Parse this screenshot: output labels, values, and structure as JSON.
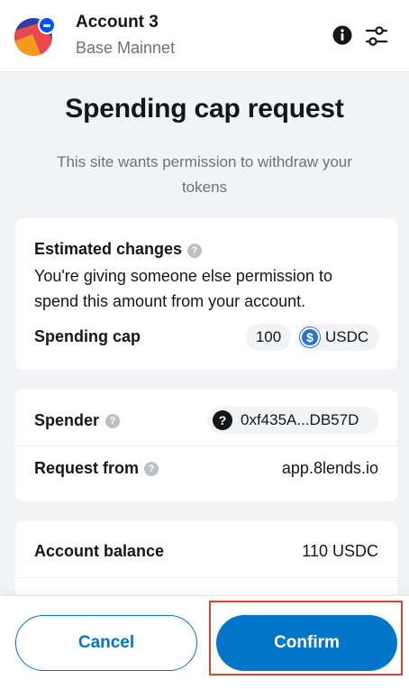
{
  "header": {
    "account_name": "Account 3",
    "network": "Base Mainnet"
  },
  "page": {
    "title": "Spending cap request",
    "subtitle": "This site wants permission to withdraw your tokens"
  },
  "estimated_changes": {
    "label": "Estimated changes",
    "description": "You're giving someone else permission to spend this amount from your account.",
    "spending_cap_label": "Spending cap",
    "amount": "100",
    "token": "USDC"
  },
  "request": {
    "spender_label": "Spender",
    "spender_address": "0xf435A...DB57D",
    "request_from_label": "Request from",
    "request_from_value": "app.8lends.io"
  },
  "balance": {
    "account_balance_label": "Account balance",
    "account_balance_value": "110 USDC"
  },
  "footer": {
    "cancel_label": "Cancel",
    "confirm_label": "Confirm"
  },
  "colors": {
    "primary": "#0376c9",
    "highlight": "#d9472b",
    "usdc": "#2775ca"
  },
  "icons": [
    "account-avatar-icon",
    "info-icon",
    "settings-sliders-icon",
    "question-help-icon",
    "usdc-token-icon",
    "unknown-address-icon"
  ]
}
